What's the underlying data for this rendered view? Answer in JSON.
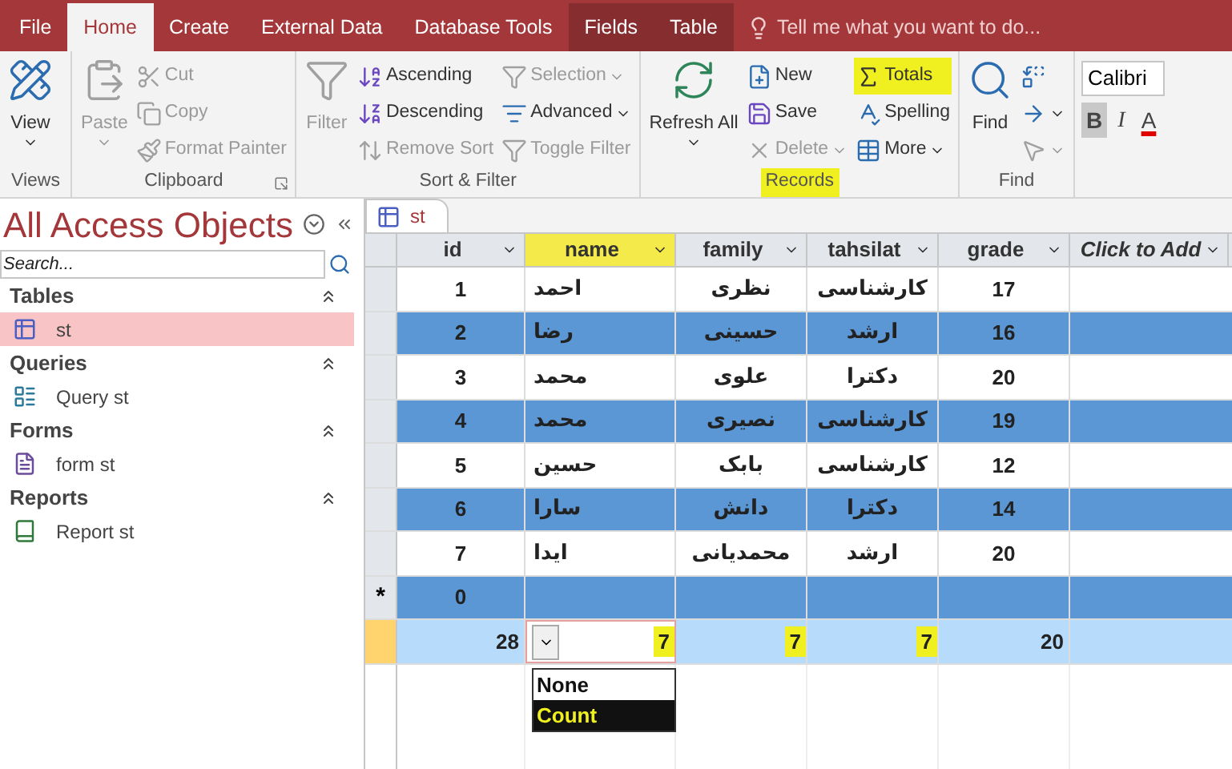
{
  "tabs": [
    {
      "label": "File",
      "selected": false,
      "kind": "standard"
    },
    {
      "label": "Home",
      "selected": true,
      "kind": "standard"
    },
    {
      "label": "Create",
      "selected": false,
      "kind": "standard"
    },
    {
      "label": "External Data",
      "selected": false,
      "kind": "standard"
    },
    {
      "label": "Database Tools",
      "selected": false,
      "kind": "standard"
    },
    {
      "label": "Fields",
      "selected": false,
      "kind": "contextual"
    },
    {
      "label": "Table",
      "selected": false,
      "kind": "contextual"
    }
  ],
  "tell_me": {
    "placeholder": "Tell me what you want to do..."
  },
  "ribbon": {
    "groups": [
      {
        "label": "Views",
        "highlighted": false,
        "large": [
          {
            "label": "View",
            "disabled": false,
            "dropdown": true
          }
        ]
      },
      {
        "label": "Clipboard",
        "highlighted": false,
        "launcher": true,
        "large": [
          {
            "label": "Paste",
            "disabled": true,
            "dropdown": true
          }
        ],
        "columns": [
          [
            {
              "label": "Cut",
              "disabled": true
            },
            {
              "label": "Copy",
              "disabled": true
            },
            {
              "label": "Format Painter",
              "disabled": true
            }
          ]
        ]
      },
      {
        "label": "Sort & Filter",
        "highlighted": false,
        "large": [
          {
            "label": "Filter",
            "disabled": true,
            "dropdown": false
          }
        ],
        "columns": [
          [
            {
              "label": "Ascending",
              "disabled": false
            },
            {
              "label": "Descending",
              "disabled": false
            },
            {
              "label": "Remove Sort",
              "disabled": true
            }
          ],
          [
            {
              "label": "Selection",
              "disabled": true,
              "dropdown": true
            },
            {
              "label": "Advanced",
              "disabled": false,
              "dropdown": true
            },
            {
              "label": "Toggle Filter",
              "disabled": true
            }
          ]
        ]
      },
      {
        "label": "Records",
        "highlighted": true,
        "large": [
          {
            "label": "Refresh All",
            "disabled": false,
            "dropdown": true
          }
        ],
        "columns": [
          [
            {
              "label": "New",
              "disabled": false
            },
            {
              "label": "Save",
              "disabled": false
            },
            {
              "label": "Delete",
              "disabled": true,
              "dropdown": true
            }
          ],
          [
            {
              "label": "Totals",
              "disabled": false,
              "highlighted": true
            },
            {
              "label": "Spelling",
              "disabled": false
            },
            {
              "label": "More",
              "disabled": false,
              "dropdown": true
            }
          ]
        ]
      },
      {
        "label": "Find",
        "highlighted": false,
        "large": [
          {
            "label": "Find",
            "disabled": false,
            "dropdown": false
          }
        ],
        "columns": [
          [
            {
              "disabled": false
            },
            {
              "disabled": false,
              "dropdown": true
            },
            {
              "disabled": true,
              "dropdown": true
            }
          ]
        ]
      }
    ],
    "font": {
      "name": "Calibri",
      "buttons": [
        {
          "label": "B",
          "selected": true,
          "kind": "bold"
        },
        {
          "label": "I",
          "selected": false,
          "kind": "italic"
        },
        {
          "label": "A",
          "selected": false,
          "kind": "color"
        }
      ]
    }
  },
  "nav": {
    "title": "All Access Objects",
    "search": {
      "placeholder": "Search..."
    },
    "sections": [
      {
        "label": "Tables",
        "expanded": true,
        "items": [
          {
            "label": "st",
            "selected": true
          }
        ]
      },
      {
        "label": "Queries",
        "expanded": true,
        "items": [
          {
            "label": "Query st",
            "selected": false
          }
        ]
      },
      {
        "label": "Forms",
        "expanded": true,
        "items": [
          {
            "label": "form st",
            "selected": false
          }
        ]
      },
      {
        "label": "Reports",
        "expanded": true,
        "items": [
          {
            "label": "Report st",
            "selected": false
          }
        ]
      }
    ]
  },
  "datasheet": {
    "tab": "st",
    "columns": [
      {
        "label": "id",
        "selected": false,
        "kind": "field"
      },
      {
        "label": "name",
        "selected": true,
        "kind": "field"
      },
      {
        "label": "family",
        "selected": false,
        "kind": "field"
      },
      {
        "label": "tahsilat",
        "selected": false,
        "kind": "field"
      },
      {
        "label": "grade",
        "selected": false,
        "kind": "field"
      },
      {
        "label": "Click to Add",
        "selected": false,
        "kind": "add"
      }
    ],
    "rows": [
      [
        "1",
        "احمد",
        "نظری",
        "کارشناسی",
        "17"
      ],
      [
        "2",
        "رضا",
        "حسینی",
        "ارشد",
        "16"
      ],
      [
        "3",
        "محمد",
        "علوی",
        "دکترا",
        "20"
      ],
      [
        "4",
        "محمد",
        "نصیری",
        "کارشناسی",
        "19"
      ],
      [
        "5",
        "حسین",
        "بابک",
        "کارشناسی",
        "12"
      ],
      [
        "6",
        "سارا",
        "دانش",
        "دکترا",
        "14"
      ],
      [
        "7",
        "ایدا",
        "محمدیانی",
        "ارشد",
        "20"
      ]
    ],
    "new_row": {
      "marker": "*",
      "id": "0"
    },
    "totals": [
      {
        "value": "28",
        "highlighted": false
      },
      {
        "value": "7",
        "highlighted": true,
        "dropdown": true
      },
      {
        "value": "7",
        "highlighted": true
      },
      {
        "value": "7",
        "highlighted": true
      },
      {
        "value": "20",
        "highlighted": false
      }
    ],
    "totals_menu": [
      {
        "label": "None",
        "selected": false,
        "highlighted": false
      },
      {
        "label": "Count",
        "selected": true,
        "highlighted": true
      }
    ]
  }
}
